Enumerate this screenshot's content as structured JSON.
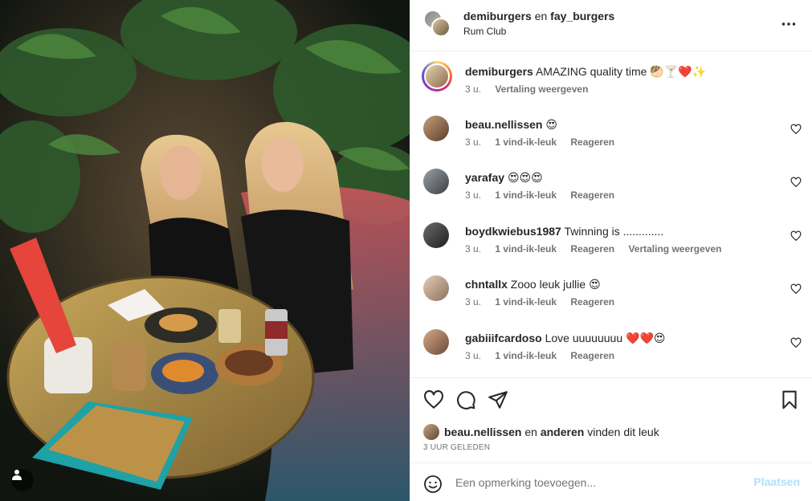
{
  "post": {
    "authors_primary": "demiburgers",
    "authors_joiner": "en",
    "authors_secondary": "fay_burgers",
    "location": "Rum Club"
  },
  "caption": {
    "user": "demiburgers",
    "text": "AMAZING quality time",
    "emoji": "🥙🍸❤️✨",
    "time": "3 u.",
    "translate": "Vertaling weergeven"
  },
  "comments": [
    {
      "user": "beau.nellissen",
      "text": "",
      "emoji": "😍",
      "time": "3 u.",
      "likes": "1 vind-ik-leuk",
      "reply": "Reageren",
      "translate": ""
    },
    {
      "user": "yarafay",
      "text": "",
      "emoji": "😍😍😍",
      "time": "3 u.",
      "likes": "1 vind-ik-leuk",
      "reply": "Reageren",
      "translate": ""
    },
    {
      "user": "boydkwiebus1987",
      "text": "Twinning is .............",
      "emoji": "",
      "time": "3 u.",
      "likes": "1 vind-ik-leuk",
      "reply": "Reageren",
      "translate": "Vertaling weergeven"
    },
    {
      "user": "chntallx",
      "text": "Zooo leuk jullie",
      "emoji": "😍",
      "time": "3 u.",
      "likes": "1 vind-ik-leuk",
      "reply": "Reageren",
      "translate": ""
    },
    {
      "user": "gabiiifcardoso",
      "text": "Love uuuuuuuu",
      "emoji": "❤️❤️😍",
      "time": "3 u.",
      "likes": "1 vind-ik-leuk",
      "reply": "Reageren",
      "translate": ""
    }
  ],
  "likes_line": {
    "user": "beau.nellissen",
    "joiner": "en",
    "others": "anderen",
    "suffix": "vinden dit leuk"
  },
  "timestamp": "3 UUR GELEDEN",
  "add_comment": {
    "placeholder": "Een opmerking toevoegen...",
    "post_label": "Plaatsen"
  },
  "icons": {
    "more": "more-horizontal-icon",
    "like": "heart-icon",
    "comment": "comment-bubble-icon",
    "share": "paper-plane-icon",
    "save": "bookmark-icon",
    "emoji": "smiley-icon",
    "tag": "user-tag-icon"
  },
  "colors": {
    "text": "#262626",
    "muted": "#737373",
    "divider": "#efefef",
    "post_disabled": "#b2dffc"
  }
}
